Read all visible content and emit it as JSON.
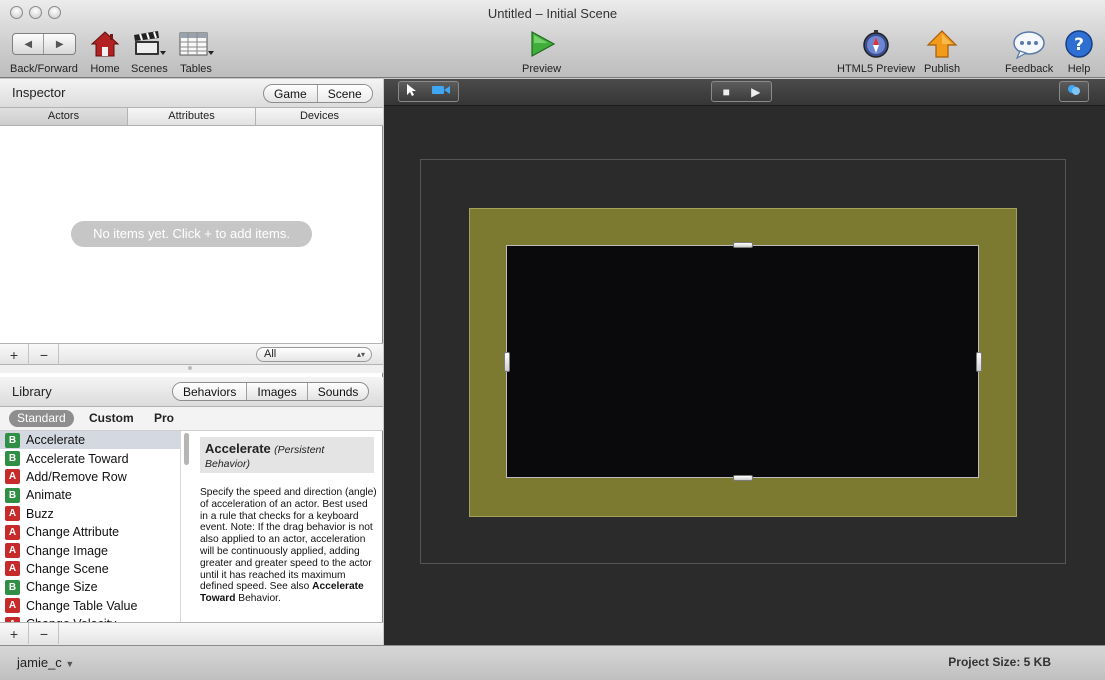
{
  "window": {
    "title": "Untitled – Initial Scene"
  },
  "toolbar": {
    "back_forward": "Back/Forward",
    "home": "Home",
    "scenes": "Scenes",
    "tables": "Tables",
    "preview": "Preview",
    "html5_preview": "HTML5 Preview",
    "publish": "Publish",
    "feedback": "Feedback",
    "help": "Help"
  },
  "inspector": {
    "title": "Inspector",
    "mode_tabs": [
      "Game",
      "Scene"
    ],
    "active_mode": "Scene",
    "tabs": [
      "Actors",
      "Attributes",
      "Devices"
    ],
    "active_tab": "Actors",
    "empty_message": "No items yet. Click + to add items.",
    "add_label": "+",
    "remove_label": "−",
    "filter_value": "All"
  },
  "library": {
    "title": "Library",
    "mode_tabs": [
      "Behaviors",
      "Images",
      "Sounds"
    ],
    "active_mode": "Behaviors",
    "sub_tabs": [
      "Standard",
      "Custom",
      "Pro"
    ],
    "active_sub_tab": "Standard",
    "items": [
      {
        "type": "B",
        "label": "Accelerate"
      },
      {
        "type": "B",
        "label": "Accelerate Toward"
      },
      {
        "type": "A",
        "label": "Add/Remove Row"
      },
      {
        "type": "B",
        "label": "Animate"
      },
      {
        "type": "A",
        "label": "Buzz"
      },
      {
        "type": "A",
        "label": "Change Attribute"
      },
      {
        "type": "A",
        "label": "Change Image"
      },
      {
        "type": "A",
        "label": "Change Scene"
      },
      {
        "type": "B",
        "label": "Change Size"
      },
      {
        "type": "A",
        "label": "Change Table Value"
      },
      {
        "type": "A",
        "label": "Change Velocity"
      }
    ],
    "selected_index": 0,
    "description": {
      "title": "Accelerate",
      "subtitle": "(Persistent Behavior)",
      "body": "Specify the speed and direction (angle) of acceleration of an actor. Best used in a rule that checks for a keyboard event. Note: If the drag behavior is not also applied to an actor, acceleration will be continuously applied, adding greater and greater speed to the actor until it has reached its maximum defined speed. See also ",
      "link": "Accelerate Toward",
      "tail": " Behavior."
    },
    "add_label": "+",
    "remove_label": "−"
  },
  "status": {
    "user": "jamie_c",
    "project_size": "Project Size: 5 KB"
  },
  "colors": {
    "scene_border": "#7c7a31",
    "scene_canvas": "#0a0a0c",
    "stage_bg": "#2b2b2b",
    "behavior_badge": "#2f8f45",
    "action_badge": "#c62a2a"
  }
}
